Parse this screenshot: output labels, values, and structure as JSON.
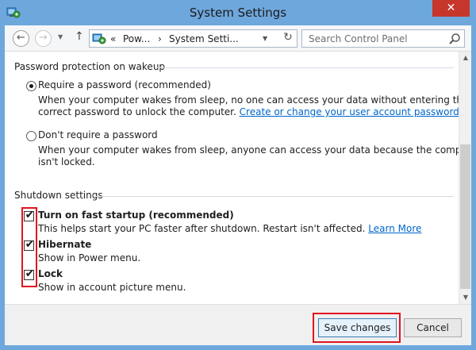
{
  "window": {
    "title": "System Settings",
    "close_glyph": "✕"
  },
  "nav": {
    "back_glyph": "←",
    "forward_glyph": "→",
    "dropdown_glyph": "▼",
    "up_glyph": "↑",
    "breadcrumb": {
      "chevrons": "«",
      "item1": "Pow...",
      "sep": "›",
      "item2": "System Setti..."
    },
    "refresh_glyph": "↻",
    "search_placeholder": "Search Control Panel"
  },
  "password_section": {
    "title": "Password protection on wakeup",
    "options": [
      {
        "label": "Require a password (recommended)",
        "selected": true,
        "desc_line1": "When your computer wakes from sleep, no one can access your data without entering the",
        "desc_line2": "correct password to unlock the computer.",
        "link": "Create or change your user account password"
      },
      {
        "label": "Don't require a password",
        "selected": false,
        "desc_line1": "When your computer wakes from sleep, anyone can access your data because the computer",
        "desc_line2": "isn't locked."
      }
    ]
  },
  "shutdown_section": {
    "title": "Shutdown settings",
    "items": [
      {
        "label": "Turn on fast startup (recommended)",
        "checked": true,
        "desc": "This helps start your PC faster after shutdown. Restart isn't affected.",
        "link": "Learn More"
      },
      {
        "label": "Hibernate",
        "checked": true,
        "desc": "Show in Power menu."
      },
      {
        "label": "Lock",
        "checked": true,
        "desc": "Show in account picture menu."
      }
    ]
  },
  "check_glyph": "✔",
  "scroll": {
    "up_glyph": "▲",
    "down_glyph": "▼"
  },
  "footer": {
    "save_label": "Save changes",
    "cancel_label": "Cancel"
  },
  "colors": {
    "titlebar": "#6ea7dc",
    "close": "#c7362b",
    "link": "#0066cc",
    "highlight": "#e0141e"
  }
}
